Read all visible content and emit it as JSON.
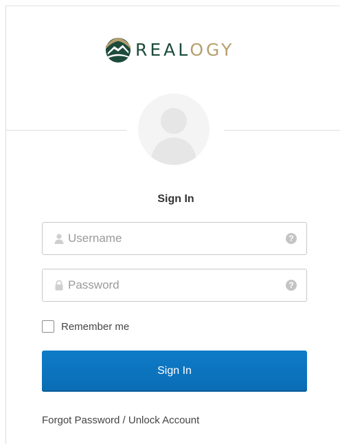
{
  "brand": {
    "logo_text_dark": "REAL",
    "logo_text_gold": "OGY",
    "logo_icon": "realogy-mountain-logo-icon",
    "color_dark": "#1d4b3b",
    "color_gold": "#b59f6e"
  },
  "avatar": {
    "icon": "default-user-avatar-icon"
  },
  "form": {
    "title": "Sign In",
    "username": {
      "placeholder": "Username",
      "value": "",
      "icon": "user-icon",
      "help_icon": "question-help-icon",
      "help_glyph": "?"
    },
    "password": {
      "placeholder": "Password",
      "value": "",
      "icon": "lock-icon",
      "help_icon": "question-help-icon",
      "help_glyph": "?"
    },
    "remember_me": {
      "label": "Remember me",
      "checked": false
    },
    "submit_label": "Sign In",
    "submit_color": "#0d73bd"
  },
  "links": {
    "forgot": "Forgot Password / Unlock Account"
  }
}
